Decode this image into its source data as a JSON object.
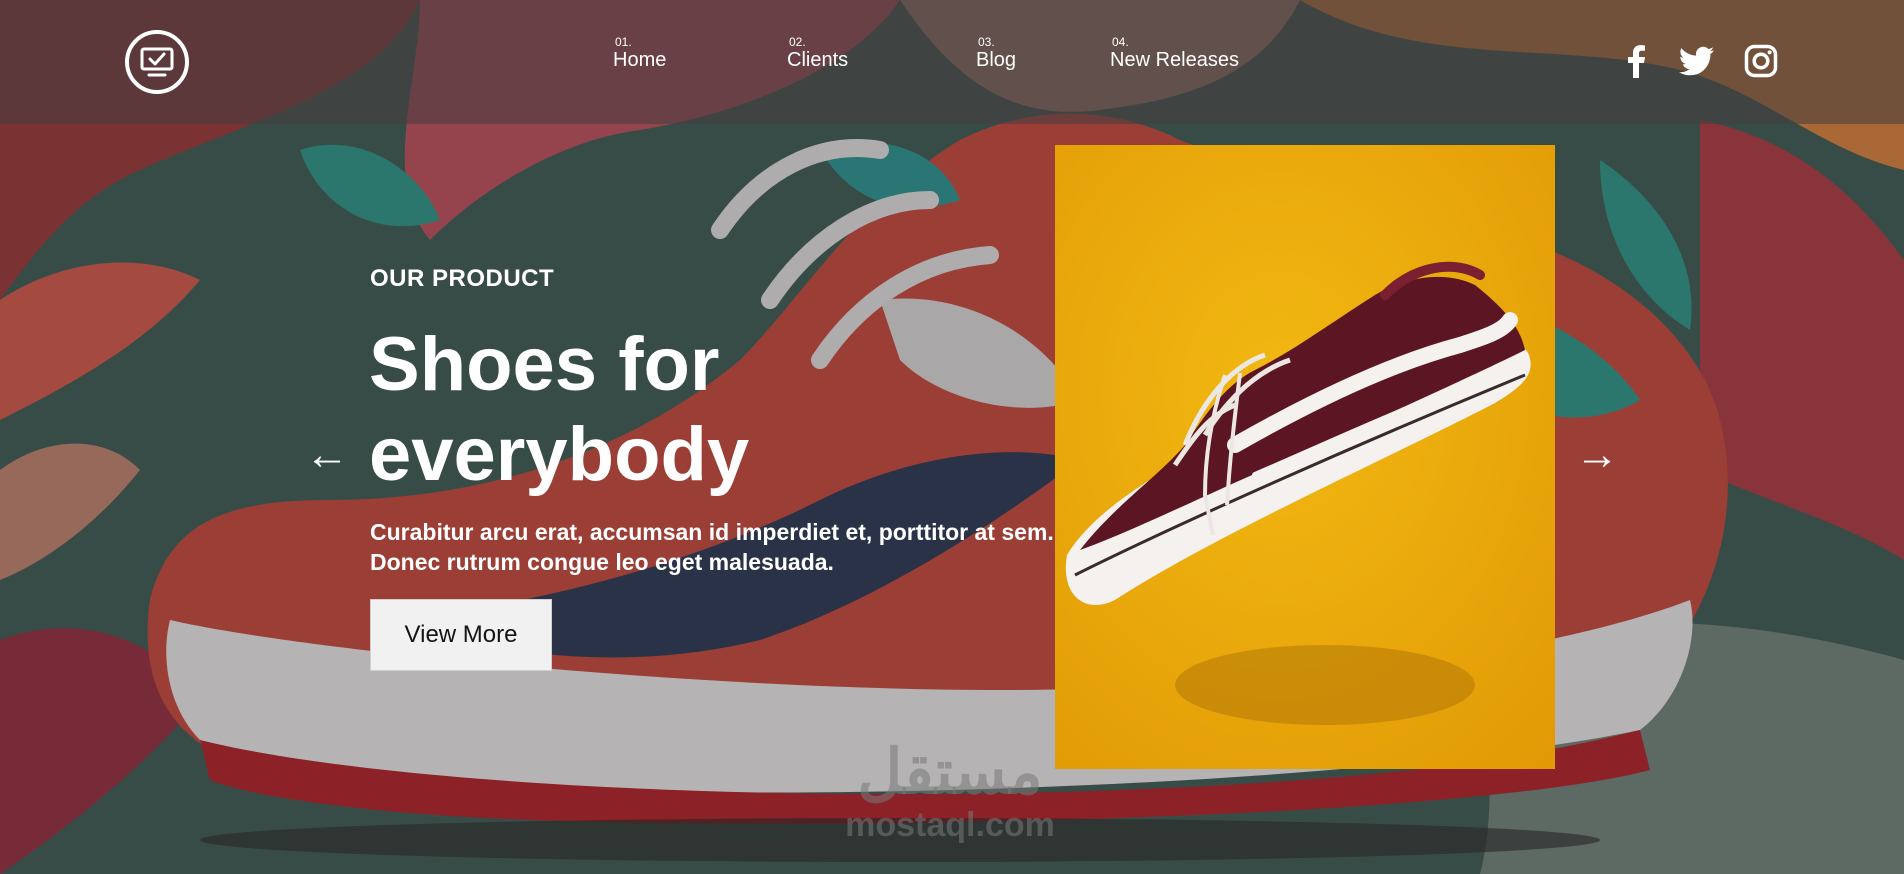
{
  "header": {
    "nav": [
      {
        "num": "01.",
        "label": "Home"
      },
      {
        "num": "02.",
        "label": "Clients"
      },
      {
        "num": "03.",
        "label": "Blog"
      },
      {
        "num": "04.",
        "label": "New Releases"
      }
    ],
    "social_icons": [
      "facebook-icon",
      "twitter-icon",
      "instagram-icon"
    ]
  },
  "hero": {
    "eyebrow": "OUR PRODUCT",
    "title_line1": "Shoes for",
    "title_line2": "everybody",
    "description": "Curabitur arcu erat, accumsan id imperdiet et, porttitor at sem. Donec rutrum congue leo eget malesuada.",
    "button_label": "View More",
    "prev_arrow": "←",
    "next_arrow": "→"
  },
  "watermark": {
    "arabic": "مستقل",
    "latin": "mostaql.com"
  },
  "colors": {
    "product_background": "#e9ae07",
    "shoe_body": "#5c1522",
    "header_overlay": "#463e40",
    "button_background": "#f2f1f1"
  }
}
